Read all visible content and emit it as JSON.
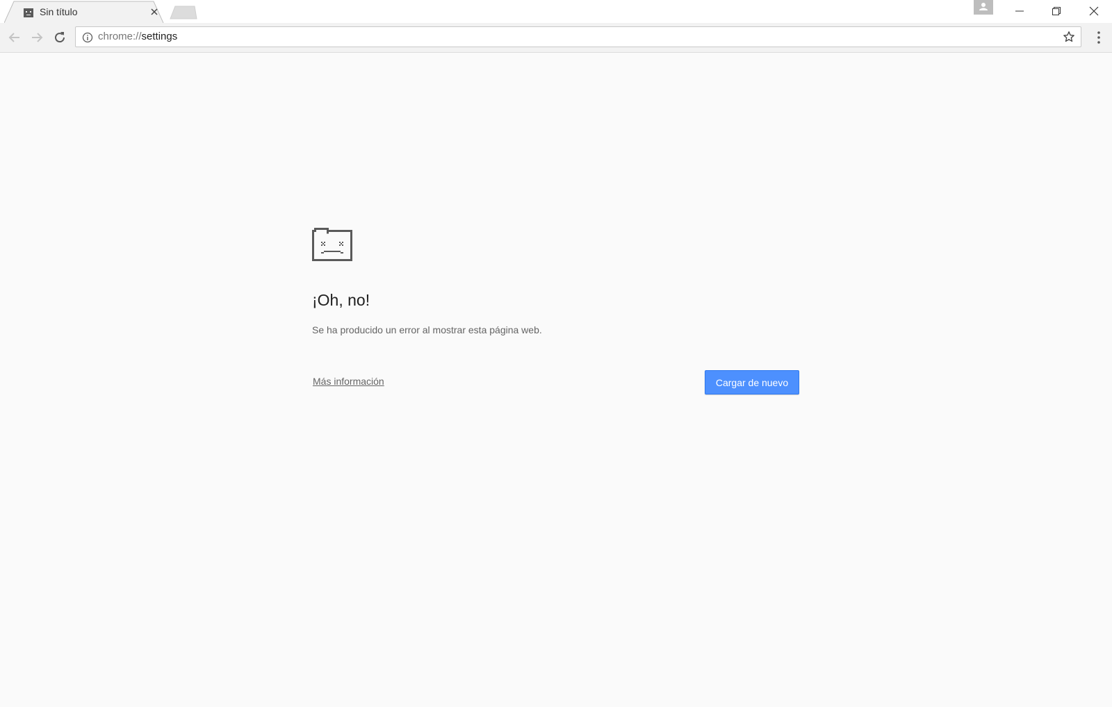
{
  "browser": {
    "tab": {
      "title": "Sin título",
      "favicon": "sad-folder-icon",
      "close": "close-icon"
    },
    "new_tab": "new-tab-icon",
    "window_controls": [
      "minimize-icon",
      "restore-icon",
      "close-icon"
    ],
    "profile": "profile-icon"
  },
  "toolbar": {
    "back": "back-arrow-icon",
    "forward": "forward-arrow-icon",
    "reload": "reload-icon",
    "address": {
      "scheme": "chrome://",
      "path": "settings",
      "full": "chrome://settings"
    },
    "site_info": "info-icon",
    "bookmark": "star-icon",
    "menu": "kebab-menu-icon"
  },
  "error_page": {
    "icon": "sad-folder-icon",
    "title": "¡Oh, no!",
    "message": "Se ha producido un error al mostrar esta página web.",
    "more_info_link": "Más información",
    "reload_button": "Cargar de nuevo"
  },
  "colors": {
    "page_background": "#fafafa",
    "button_primary": "#4d90fe",
    "button_border": "#3079ed",
    "icon_gray": "#5a5a5a"
  }
}
